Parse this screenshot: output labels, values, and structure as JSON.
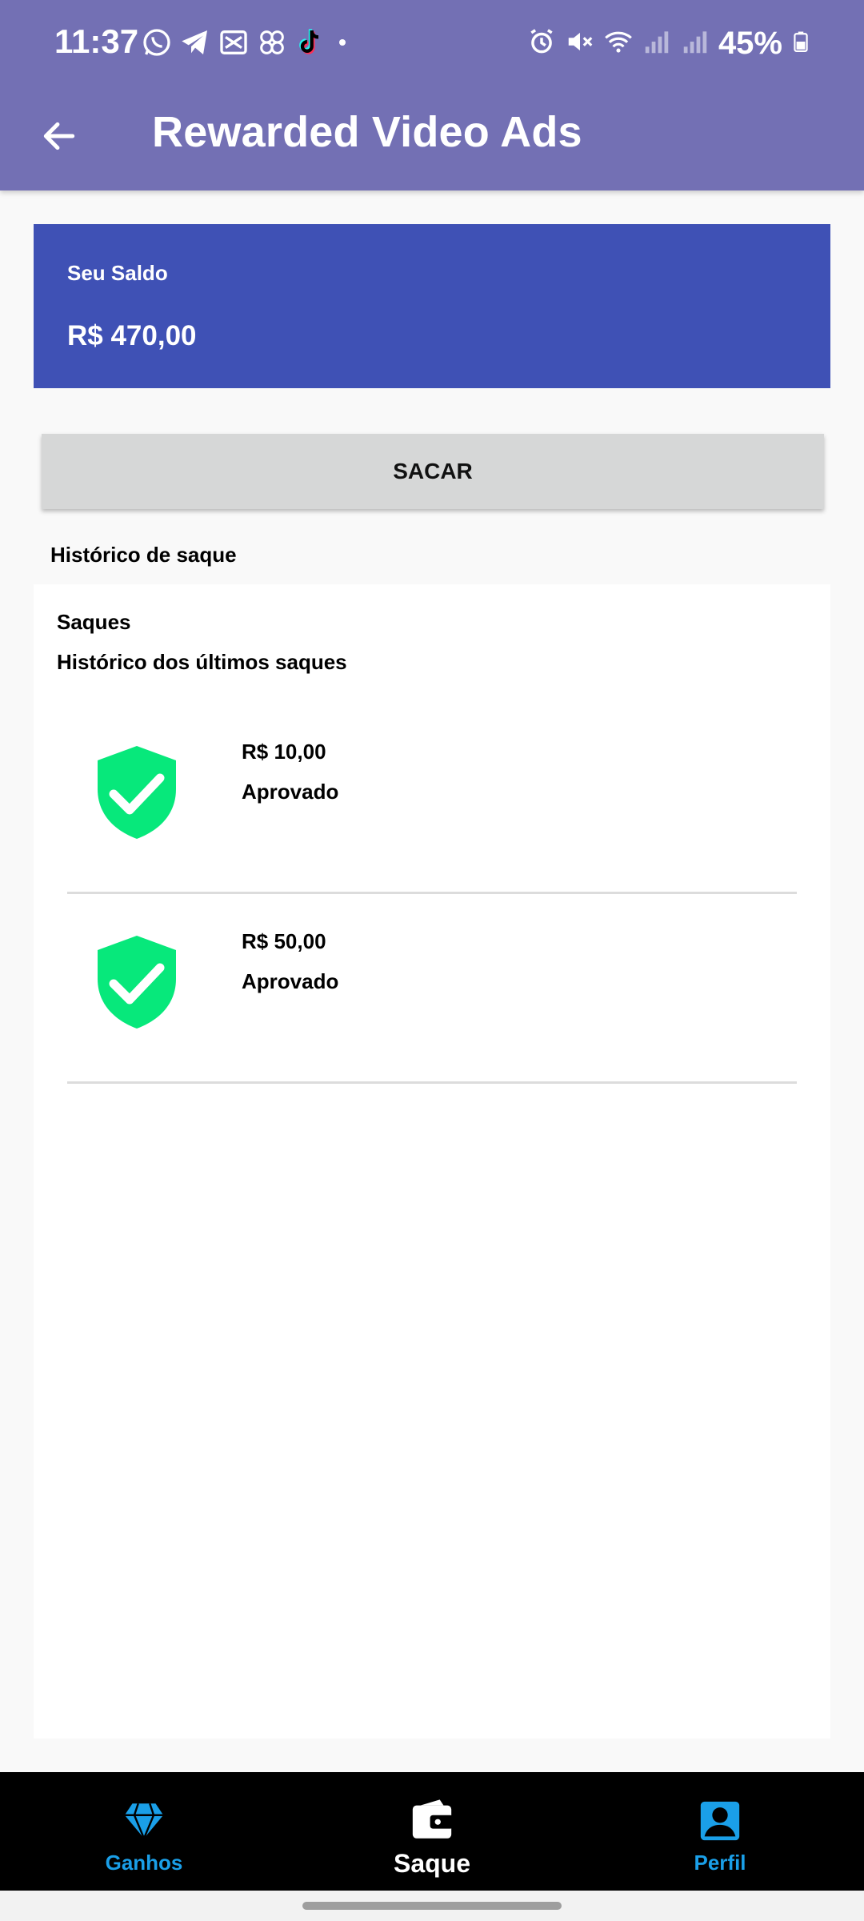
{
  "status_bar": {
    "time": "11:37",
    "battery_percent": "45%",
    "left_icons": [
      "whatsapp-icon",
      "telegram-icon",
      "capcut-icon",
      "flower-app-icon",
      "tiktok-icon",
      "dot-icon"
    ],
    "right_icons": [
      "alarm-icon",
      "mute-icon",
      "wifi-icon",
      "signal-icon",
      "signal-icon",
      "battery-icon"
    ]
  },
  "app_bar": {
    "title": "Rewarded Video Ads",
    "back_icon": "arrow-left-icon"
  },
  "balance": {
    "label": "Seu Saldo",
    "value": "R$ 470,00"
  },
  "withdraw_button": {
    "label": "SACAR"
  },
  "history": {
    "section_title": "Histórico de saque",
    "panel_title": "Saques",
    "panel_subtitle": "Histórico dos últimos saques",
    "items": [
      {
        "amount": "R$ 10,00",
        "status": "Aprovado",
        "icon": "shield-check-icon"
      },
      {
        "amount": "R$ 50,00",
        "status": "Aprovado",
        "icon": "shield-check-icon"
      }
    ]
  },
  "bottom_nav": {
    "items": [
      {
        "label": "Ganhos",
        "icon": "diamond-icon",
        "active": false
      },
      {
        "label": "Saque",
        "icon": "wallet-icon",
        "active": true
      },
      {
        "label": "Perfil",
        "icon": "profile-icon",
        "active": false
      }
    ]
  },
  "colors": {
    "header": "#7370b4",
    "balance_card": "#3f51b5",
    "button_gray": "#d6d7d7",
    "approved_green": "#07e87b",
    "nav_accent": "#1a9fe8",
    "nav_background": "#000000"
  }
}
